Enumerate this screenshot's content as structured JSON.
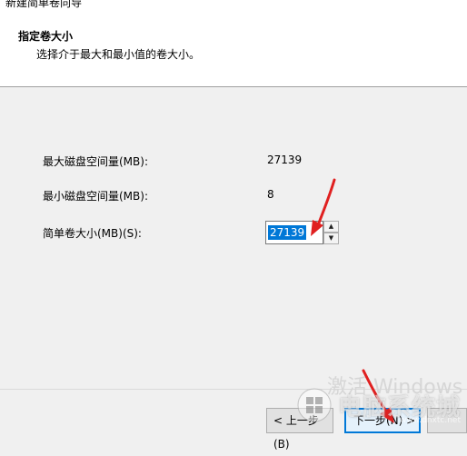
{
  "window": {
    "title": "新建简单卷向导"
  },
  "header": {
    "title": "指定卷大小",
    "subtitle": "选择介于最大和最小值的卷大小。"
  },
  "fields": {
    "max_label": "最大磁盘空间量(MB):",
    "max_value": "27139",
    "min_label": "最小磁盘空间量(MB):",
    "min_value": "8",
    "size_label": "简单卷大小(MB)(S):",
    "size_value": "27139"
  },
  "buttons": {
    "back": "< 上一步(B)",
    "next": "下一步(N) >"
  },
  "overlay": {
    "activate": "激活 Windows",
    "watermark": "电脑系统城",
    "watermark_url": "www.dnxtc.net"
  },
  "colors": {
    "accent": "#0078d7",
    "arrow": "#e02020"
  },
  "icons": {
    "spin_up": "triangle-up",
    "spin_down": "triangle-down",
    "annotation": "red-arrow"
  }
}
